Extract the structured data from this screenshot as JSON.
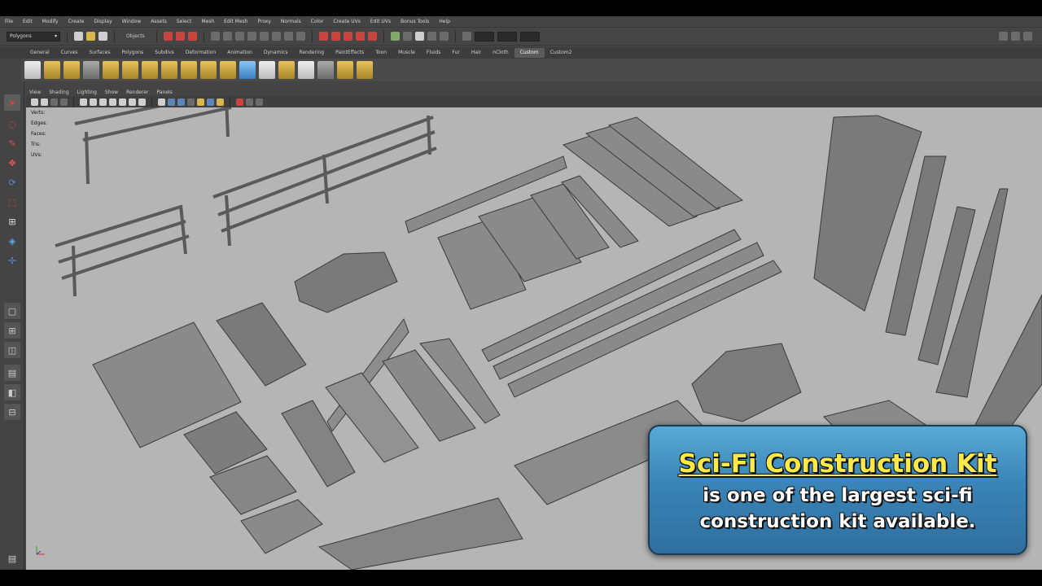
{
  "menubar": {
    "items": [
      "File",
      "Edit",
      "Modify",
      "Create",
      "Display",
      "Window",
      "Assets",
      "Select",
      "Mesh",
      "Edit Mesh",
      "Proxy",
      "Normals",
      "Color",
      "Create UVs",
      "Edit UVs",
      "Bonus Tools",
      "Help"
    ]
  },
  "statusline": {
    "mode": "Polygons",
    "objects_label": "Objects"
  },
  "shelf_tabs": {
    "items": [
      "General",
      "Curves",
      "Surfaces",
      "Polygons",
      "Subdivs",
      "Deformation",
      "Animation",
      "Dynamics",
      "Rendering",
      "PaintEffects",
      "Toon",
      "Muscle",
      "Fluids",
      "Fur",
      "Hair",
      "nCloth",
      "Custom",
      "Custom2"
    ],
    "active_index": 16
  },
  "viewport_menu": {
    "items": [
      "View",
      "Shading",
      "Lighting",
      "Show",
      "Renderer",
      "Panels"
    ]
  },
  "heads_up": {
    "rows": [
      {
        "label": "Verts:"
      },
      {
        "label": "Edges:"
      },
      {
        "label": "Faces:"
      },
      {
        "label": "Tris:"
      },
      {
        "label": "UVs:"
      }
    ]
  },
  "banner": {
    "title": "Sci-Fi Construction Kit",
    "line1": "is one of the largest sci-fi",
    "line2": "construction kit available."
  },
  "colors": {
    "viewport_bg": "#b5b5b5",
    "mesh_gray": "#8e8e8e",
    "banner_blue": "#3a84b7",
    "title_yellow": "#ffe84a"
  }
}
